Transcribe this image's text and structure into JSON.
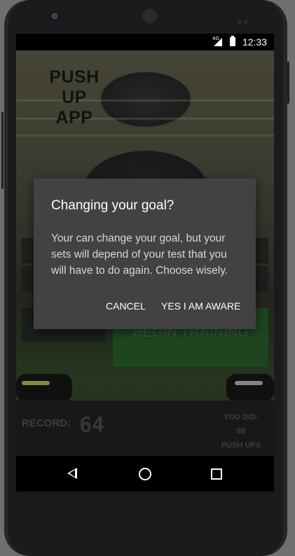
{
  "status_bar": {
    "network": "4G",
    "time": "12:33"
  },
  "app": {
    "title_line1": "PUSH UP",
    "title_line2": "APP",
    "begin_training_label": "BEGIN TRAINING",
    "record_label": "RECORD:",
    "record_value": "64",
    "you_did_label": "YOU DID:",
    "you_did_value": "68",
    "you_did_unit": "PUSH UPS"
  },
  "dialog": {
    "title": "Changing your goal?",
    "message": "Your can change your goal, but your sets will depend of your test that you will have to do again. Choose wisely.",
    "cancel_label": "CANCEL",
    "confirm_label": "YES I AM AWARE"
  },
  "colors": {
    "dialog_background": "#424242",
    "begin_button": "#2f6a32",
    "bottom_panel": "#262626"
  }
}
